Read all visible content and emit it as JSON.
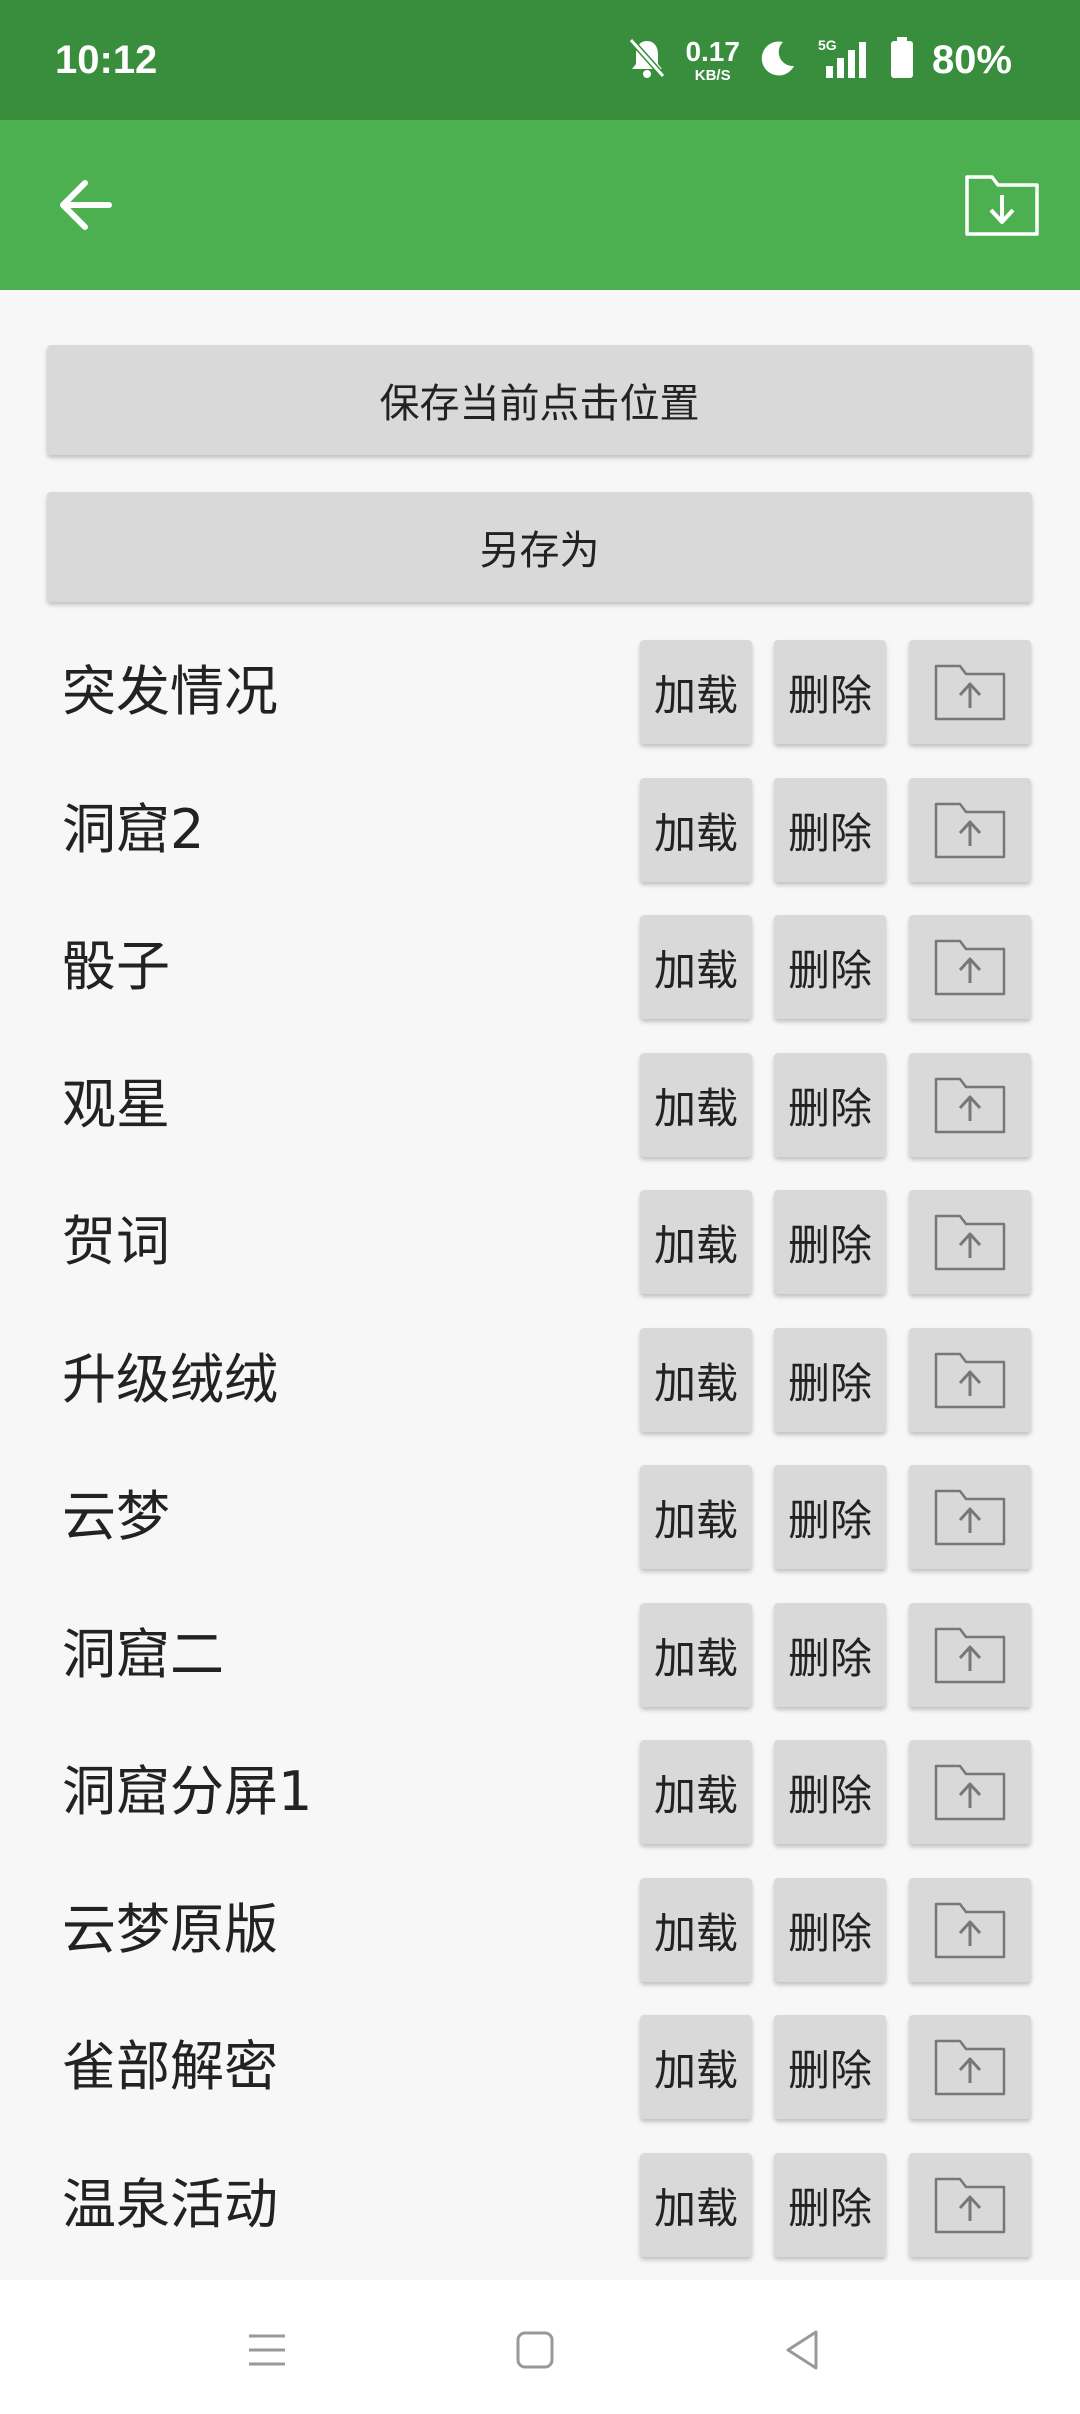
{
  "status_bar": {
    "time": "10:12",
    "net_speed_value": "0.17",
    "net_speed_unit": "KB/S",
    "network_type": "5G",
    "battery": "80%",
    "icons": [
      "bell-muted-icon",
      "moon-icon",
      "signal-icon",
      "battery-icon"
    ]
  },
  "app_bar": {
    "back_icon": "arrow-left-icon",
    "import_icon": "folder-download-icon"
  },
  "actions": {
    "save_current": "保存当前点击位置",
    "save_as": "另存为"
  },
  "row_buttons": {
    "load": "加载",
    "delete": "删除",
    "upload_icon": "folder-upload-icon"
  },
  "configs": [
    {
      "name": "突发情况"
    },
    {
      "name": "洞窟2"
    },
    {
      "name": "骰子"
    },
    {
      "name": "观星"
    },
    {
      "name": "贺词"
    },
    {
      "name": "升级绒绒"
    },
    {
      "name": "云梦"
    },
    {
      "name": "洞窟二"
    },
    {
      "name": "洞窟分屏1"
    },
    {
      "name": "云梦原版"
    },
    {
      "name": "雀部解密"
    },
    {
      "name": "温泉活动"
    }
  ],
  "nav_bar": {
    "icons": [
      "menu-icon",
      "home-square-icon",
      "back-triangle-icon"
    ]
  },
  "colors": {
    "status_bar": "#388e3c",
    "app_bar": "#4caf50",
    "button_bg": "#d9d9d9",
    "page_bg": "#f7f7f7"
  }
}
